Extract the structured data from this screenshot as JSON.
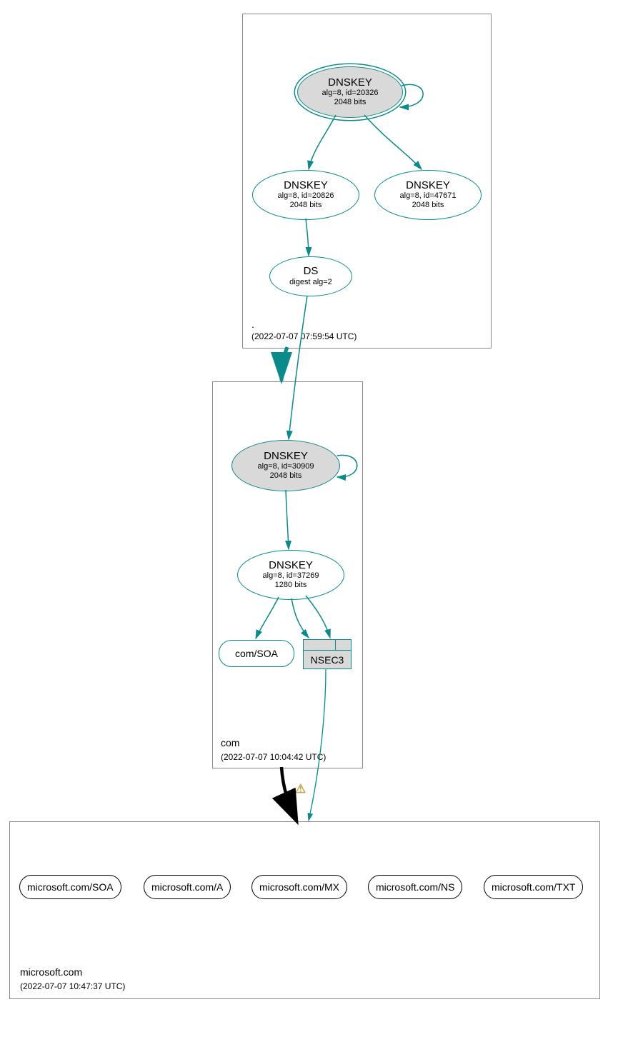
{
  "zones": {
    "root": {
      "label": ".",
      "timestamp": "(2022-07-07 07:59:54 UTC)"
    },
    "com": {
      "label": "com",
      "timestamp": "(2022-07-07 10:04:42 UTC)"
    },
    "ms": {
      "label": "microsoft.com",
      "timestamp": "(2022-07-07 10:47:37 UTC)"
    }
  },
  "nodes": {
    "root_ksk": {
      "title": "DNSKEY",
      "l1": "alg=8, id=20326",
      "l2": "2048 bits"
    },
    "root_zsk1": {
      "title": "DNSKEY",
      "l1": "alg=8, id=20826",
      "l2": "2048 bits"
    },
    "root_zsk2": {
      "title": "DNSKEY",
      "l1": "alg=8, id=47671",
      "l2": "2048 bits"
    },
    "root_ds": {
      "title": "DS",
      "l1": "digest alg=2"
    },
    "com_ksk": {
      "title": "DNSKEY",
      "l1": "alg=8, id=30909",
      "l2": "2048 bits"
    },
    "com_zsk": {
      "title": "DNSKEY",
      "l1": "alg=8, id=37269",
      "l2": "1280 bits"
    },
    "com_soa": {
      "label": "com/SOA"
    },
    "nsec3": {
      "label": "NSEC3"
    },
    "ms_soa": {
      "label": "microsoft.com/SOA"
    },
    "ms_a": {
      "label": "microsoft.com/A"
    },
    "ms_mx": {
      "label": "microsoft.com/MX"
    },
    "ms_ns": {
      "label": "microsoft.com/NS"
    },
    "ms_txt": {
      "label": "microsoft.com/TXT"
    }
  },
  "icons": {
    "warning": "⚠"
  }
}
